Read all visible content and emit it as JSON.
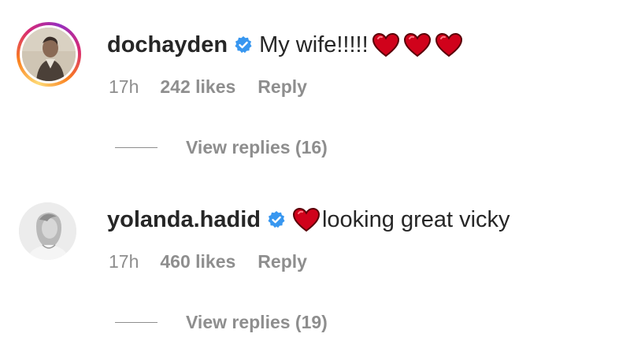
{
  "colors": {
    "text_primary": "#262626",
    "text_secondary": "#8e8e8e",
    "verified_blue": "#3897f0",
    "heart_red": "#d0021b"
  },
  "comments": [
    {
      "username": "dochayden",
      "verified": true,
      "verified_icon": "verified-badge-icon",
      "hearts_position": "after-text",
      "text": "My wife!!!!!",
      "hearts": [
        "red-heart-icon",
        "red-heart-icon",
        "red-heart-icon"
      ],
      "time": "17h",
      "likes": "242 likes",
      "reply_label": "Reply",
      "view_replies": "View replies (16)"
    },
    {
      "username": "yolanda.hadid",
      "verified": true,
      "verified_icon": "verified-badge-icon",
      "hearts_position": "before-text",
      "text": "looking great vicky",
      "hearts": [
        "red-heart-icon"
      ],
      "time": "17h",
      "likes": "460 likes",
      "reply_label": "Reply",
      "view_replies": "View replies (19)"
    }
  ]
}
